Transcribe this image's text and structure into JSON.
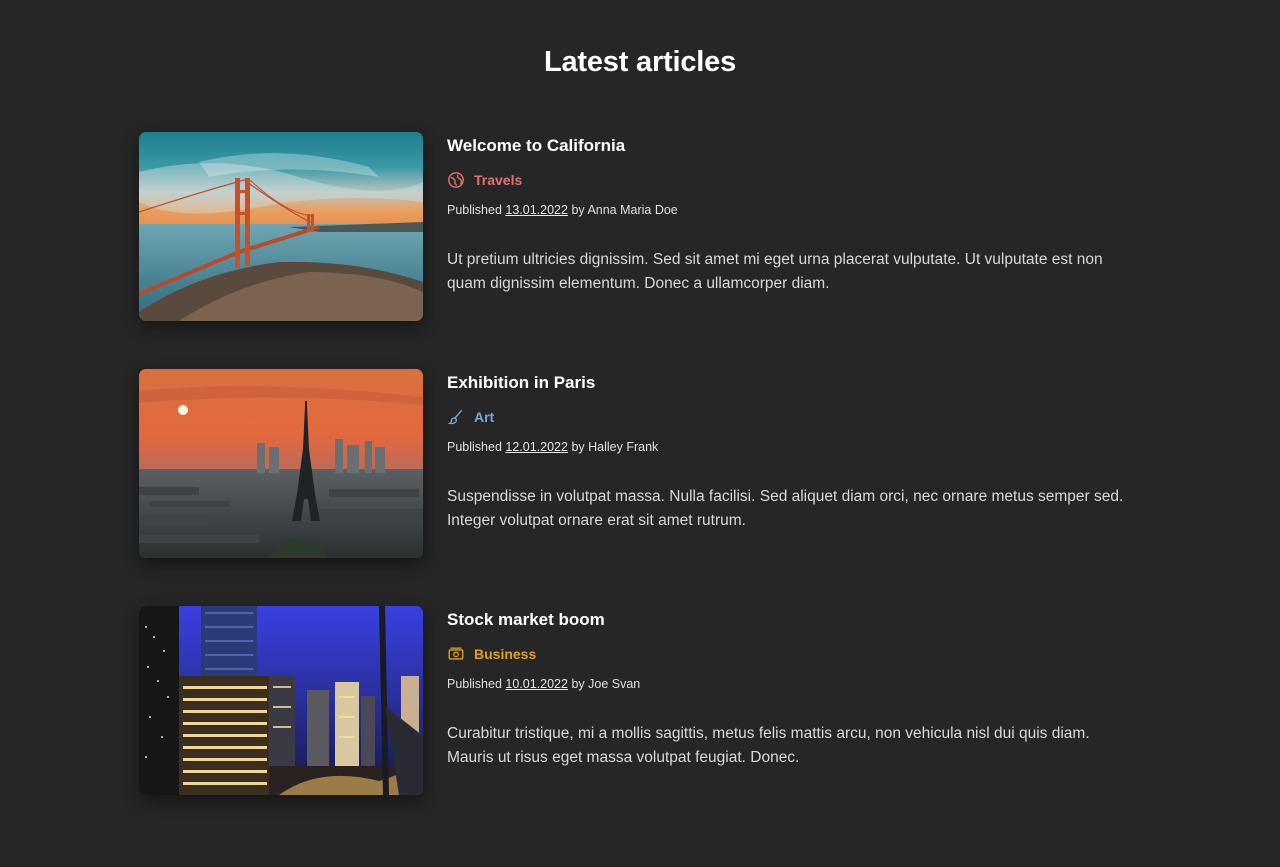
{
  "page": {
    "title": "Latest articles"
  },
  "colors": {
    "background": "#262626",
    "travels": "#e07070",
    "art": "#7aa7d6",
    "business": "#e0a020"
  },
  "articles": [
    {
      "title": "Welcome to California",
      "category": "Travels",
      "category_icon": "globe-icon",
      "category_color": "#e07070",
      "published_label": "Published",
      "date": "13.01.2022",
      "by_label": "by",
      "author": "Anna Maria Doe",
      "excerpt": "Ut pretium ultricies dignissim. Sed sit amet mi eget urna placerat vulputate. Ut vulputate est non quam dignissim elementum. Donec a ullamcorper diam.",
      "image": "golden-gate-bridge"
    },
    {
      "title": "Exhibition in Paris",
      "category": "Art",
      "category_icon": "paintbrush-icon",
      "category_color": "#7aa7d6",
      "published_label": "Published",
      "date": "12.01.2022",
      "by_label": "by",
      "author": "Halley Frank",
      "excerpt": "Suspendisse in volutpat massa. Nulla facilisi. Sed aliquet diam orci, nec ornare metus semper sed. Integer volutpat ornare erat sit amet rutrum.",
      "image": "paris-eiffel-tower"
    },
    {
      "title": "Stock market boom",
      "category": "Business",
      "category_icon": "money-bill-icon",
      "category_color": "#e0a020",
      "published_label": "Published",
      "date": "10.01.2022",
      "by_label": "by",
      "author": "Joe Svan",
      "excerpt": "Curabitur tristique, mi a mollis sagittis, metus felis mattis arcu, non vehicula nisl dui quis diam. Mauris ut risus eget massa volutpat feugiat. Donec.",
      "image": "city-skyline-night"
    }
  ]
}
